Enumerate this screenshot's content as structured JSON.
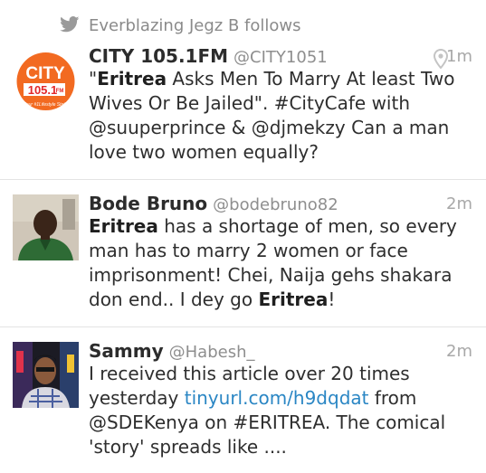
{
  "context": {
    "text": "Everblazing Jegz B follows",
    "icon": "bird-icon"
  },
  "tweets": [
    {
      "name": "CITY 105.1FM",
      "handle": "@CITY1051",
      "time": "1m",
      "body": [
        {
          "t": "\"",
          "b": false
        },
        {
          "t": "Eritrea",
          "b": true
        },
        {
          "t": " Asks Men To Marry At least Two Wives Or Be Jailed\". #CityCafe with @suuperprince & @djmekzy Can a man love two women equally?",
          "b": false
        }
      ],
      "avatar": {
        "brand": "CITY",
        "freq": "105.1",
        "unit": "FM",
        "tagline": "...Your #1Lifestyle Station"
      }
    },
    {
      "name": "Bode Bruno",
      "handle": "@bodebruno82",
      "time": "2m",
      "body": [
        {
          "t": "Eritrea",
          "b": true
        },
        {
          "t": " has a shortage of men, so every man has to marry 2 women or face imprisonment! Chei, Naija gehs shakara don end.. I dey go ",
          "b": false
        },
        {
          "t": "Eritrea",
          "b": true
        },
        {
          "t": "!",
          "b": false
        }
      ]
    },
    {
      "name": "Sammy",
      "handle": "@Habesh_",
      "time": "2m",
      "body": [
        {
          "t": "I received this article over 20 times yesterday ",
          "b": false
        },
        {
          "t": "tinyurl.com/h9dqdat",
          "link": true
        },
        {
          "t": " from @SDEKenya on #ERITREA. The comical 'story' spreads like ....",
          "b": false
        }
      ]
    }
  ],
  "colors": {
    "link": "#2a86c4",
    "brand_orange": "#f26a21",
    "muted": "#8e8e8e"
  }
}
